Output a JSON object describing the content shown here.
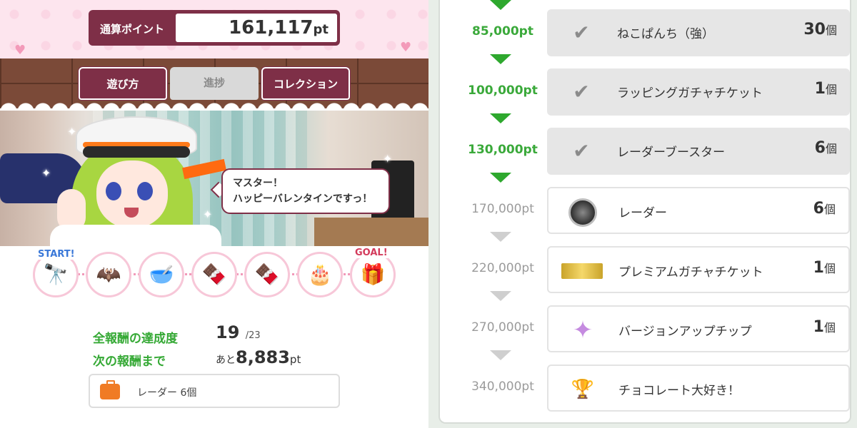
{
  "points": {
    "label": "通算ポイント",
    "value": "161,117",
    "unit": "pt"
  },
  "tabs": [
    {
      "label": "遊び方",
      "active": true
    },
    {
      "label": "進捗",
      "active": false
    },
    {
      "label": "コレクション",
      "active": true
    }
  ],
  "speech": {
    "line1": "マスター！",
    "line2": "ハッピーバレンタインですっ！"
  },
  "path": {
    "start_label": "START!",
    "goal_label": "GOAL!"
  },
  "stats": {
    "completion_label": "全報酬の達成度",
    "completion_value": "19",
    "completion_total": "/23",
    "next_label": "次の報酬まで",
    "next_prefix": "あと",
    "next_value": "8,883",
    "next_unit": "pt"
  },
  "next_reward": {
    "icon": "toolbox-icon",
    "text": "レーダー 6個"
  },
  "milestones": [
    {
      "points": "85,000pt",
      "achieved": true,
      "reward": "ねこぱんち（強）",
      "count": "30",
      "unit": "個",
      "icon": "check-icon"
    },
    {
      "points": "100,000pt",
      "achieved": true,
      "reward": "ラッピングガチャチケット",
      "count": "1",
      "unit": "個",
      "icon": "check-icon"
    },
    {
      "points": "130,000pt",
      "achieved": true,
      "reward": "レーダーブースター",
      "count": "6",
      "unit": "個",
      "icon": "check-icon"
    },
    {
      "points": "170,000pt",
      "achieved": false,
      "reward": "レーダー",
      "count": "6",
      "unit": "個",
      "icon": "radar-icon"
    },
    {
      "points": "220,000pt",
      "achieved": false,
      "reward": "プレミアムガチャチケット",
      "count": "1",
      "unit": "個",
      "icon": "ticket-icon"
    },
    {
      "points": "270,000pt",
      "achieved": false,
      "reward": "バージョンアップチップ",
      "count": "1",
      "unit": "個",
      "icon": "chip-icon"
    },
    {
      "points": "340,000pt",
      "achieved": false,
      "reward": "チョコレート大好き！",
      "count": "",
      "unit": "",
      "icon": "trophy-icon"
    }
  ],
  "colors": {
    "accent": "#7e2f47",
    "achieved": "#35a935",
    "pending": "#9b9b9b"
  }
}
